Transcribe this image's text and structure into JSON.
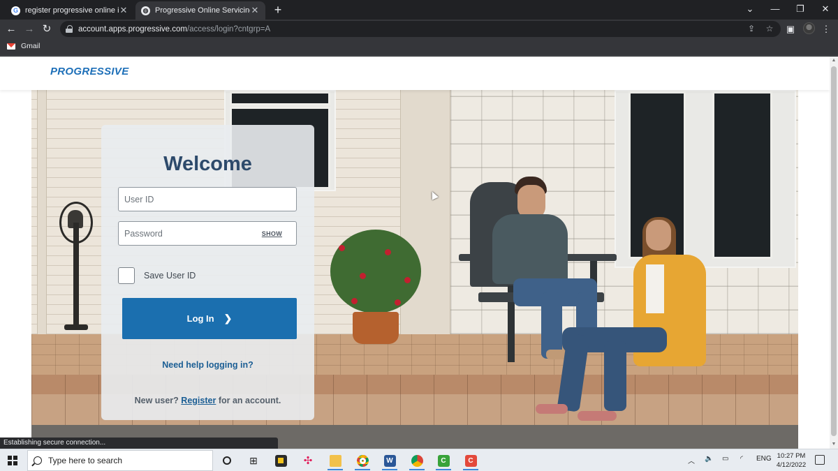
{
  "browser": {
    "tabs": [
      {
        "title": "register progressive online insura",
        "active": false
      },
      {
        "title": "Progressive Online Servicing",
        "active": true
      }
    ],
    "url_host": "account.apps.progressive.com",
    "url_path": "/access/login?cntgrp=A",
    "bookmarks": [
      {
        "label": "Gmail"
      }
    ],
    "status_text": "Establishing secure connection..."
  },
  "site": {
    "logo_text": "PROGRESSIVE",
    "brand_color": "#1d6fb8"
  },
  "login": {
    "heading": "Welcome",
    "user_id_placeholder": "User ID",
    "password_placeholder": "Password",
    "show_label": "SHOW",
    "save_user_label": "Save User ID",
    "save_user_checked": false,
    "login_button": "Log In",
    "help_link": "Need help logging in?",
    "new_user_prefix": "New user?",
    "register_link": "Register",
    "new_user_suffix": "for an account.",
    "button_color": "#1b6faf",
    "heading_color": "#2d4a6b"
  },
  "taskbar": {
    "search_placeholder": "Type here to search",
    "apps": [
      "task-view",
      "widgets",
      "sticky-notes",
      "slack",
      "file-explorer",
      "chrome",
      "word",
      "chrome-profile",
      "camtasia-green",
      "camtasia-red"
    ],
    "language": "ENG",
    "time": "10:27 PM",
    "date": "4/12/2022"
  }
}
